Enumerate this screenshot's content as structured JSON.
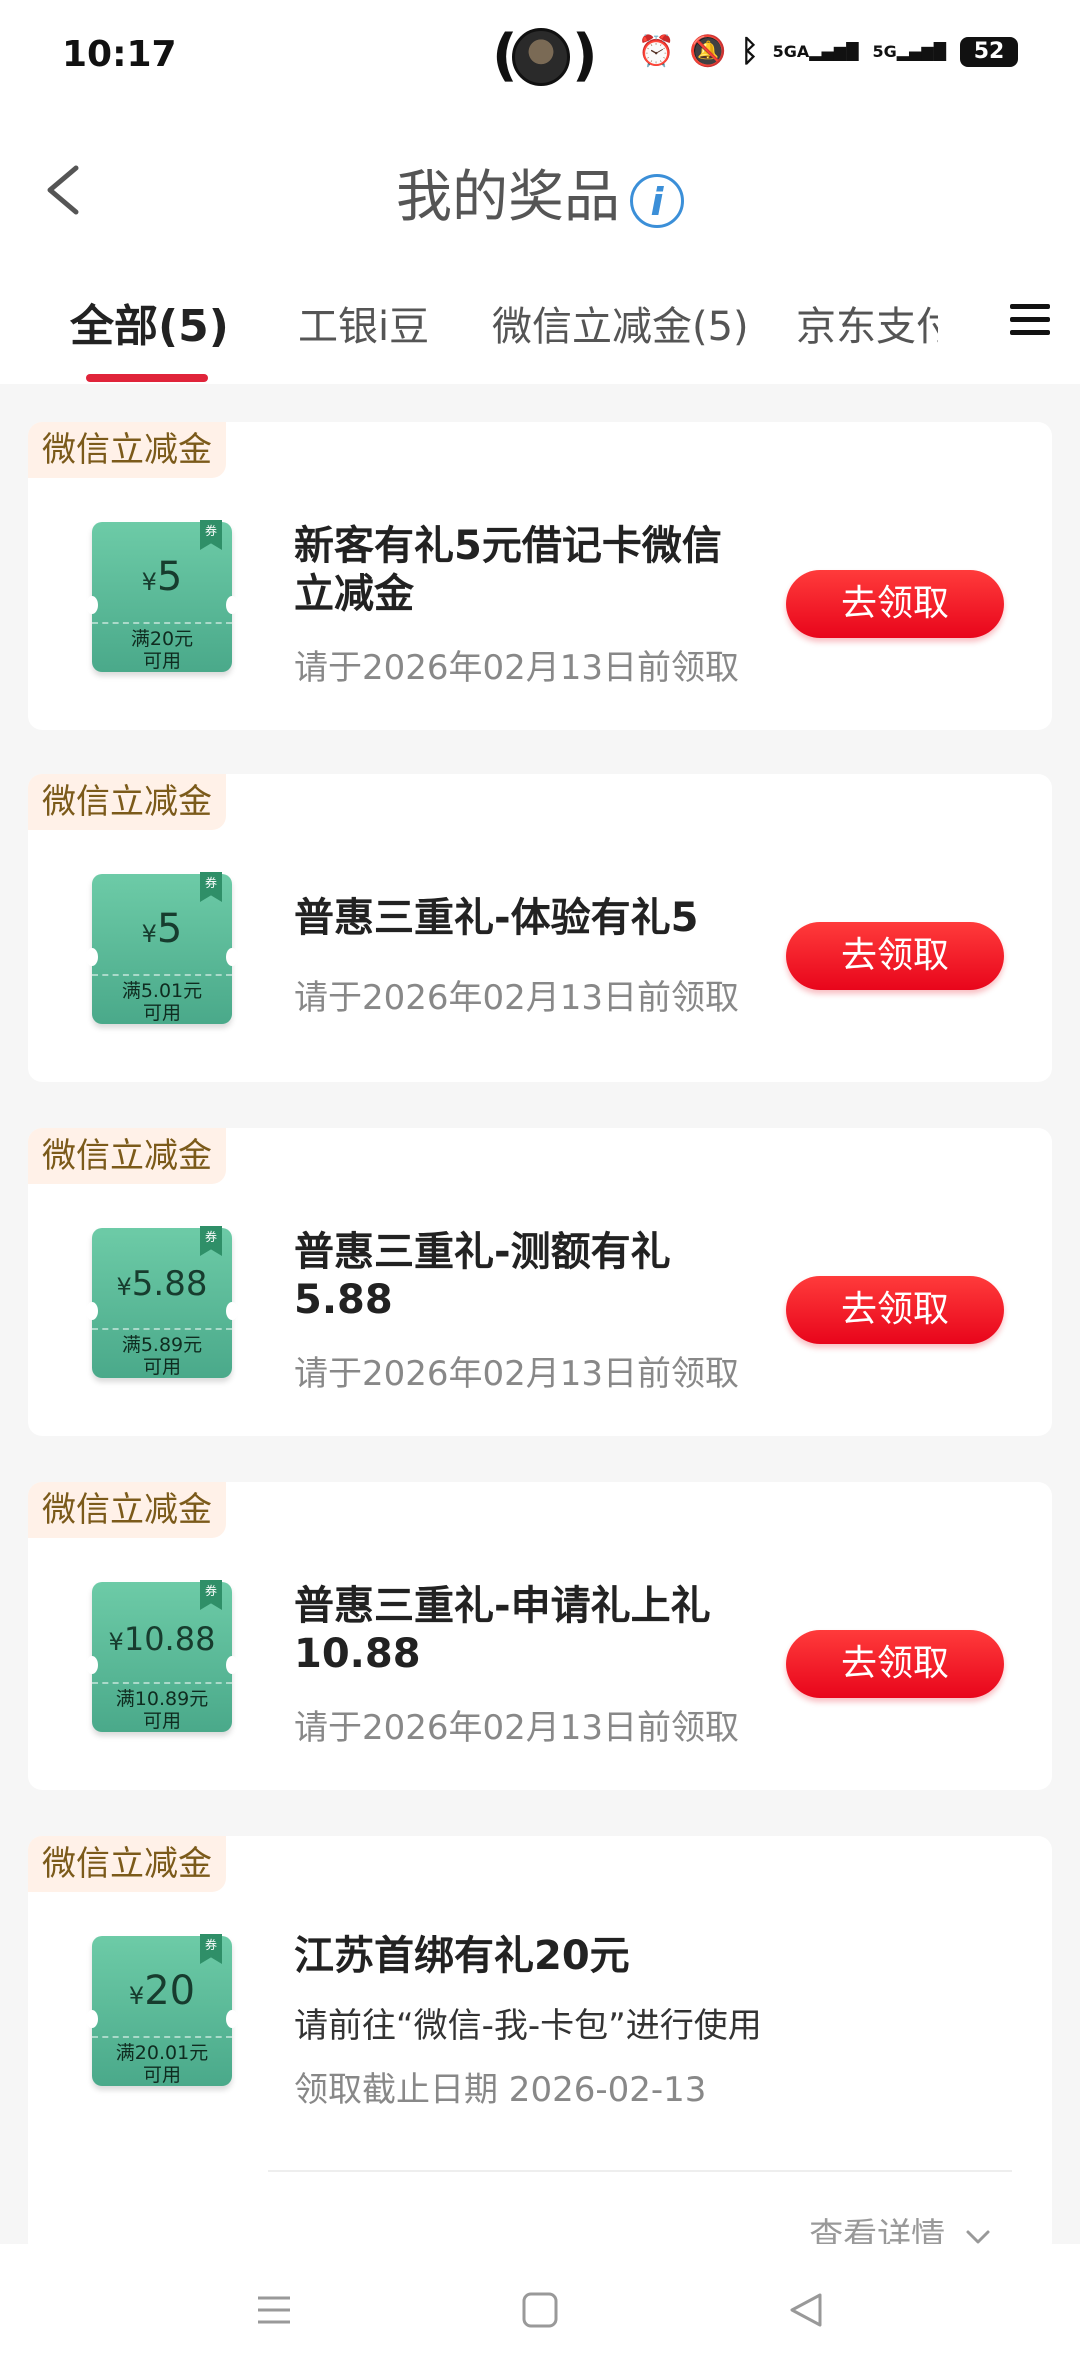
{
  "status_bar": {
    "time": "10:17",
    "battery": "52",
    "signal_labels": [
      "5GA",
      "5G"
    ]
  },
  "header": {
    "title": "我的奖品",
    "info_icon": "i"
  },
  "tabs": [
    {
      "label": "全部(5)",
      "active": true
    },
    {
      "label": "工银i豆",
      "active": false
    },
    {
      "label": "微信立减金(5)",
      "active": false
    },
    {
      "label": "京东支付",
      "active": false
    }
  ],
  "prizes": [
    {
      "tag": "微信立减金",
      "coupon_currency": "¥",
      "coupon_amount": "5",
      "coupon_condition": "满20元",
      "coupon_usable": "可用",
      "coupon_badge": "券",
      "name": "新客有礼5元借记卡微信立减金",
      "deadline": "请于2026年02月13日前领取",
      "action": "去领取"
    },
    {
      "tag": "微信立减金",
      "coupon_currency": "¥",
      "coupon_amount": "5",
      "coupon_condition": "满5.01元",
      "coupon_usable": "可用",
      "coupon_badge": "券",
      "name": "普惠三重礼-体验有礼5",
      "deadline": "请于2026年02月13日前领取",
      "action": "去领取"
    },
    {
      "tag": "微信立减金",
      "coupon_currency": "¥",
      "coupon_amount": "5.88",
      "coupon_condition": "满5.89元",
      "coupon_usable": "可用",
      "coupon_badge": "券",
      "name": "普惠三重礼-测额有礼5.88",
      "deadline": "请于2026年02月13日前领取",
      "action": "去领取"
    },
    {
      "tag": "微信立减金",
      "coupon_currency": "¥",
      "coupon_amount": "10.88",
      "coupon_condition": "满10.89元",
      "coupon_usable": "可用",
      "coupon_badge": "券",
      "name": "普惠三重礼-申请礼上礼10.88",
      "deadline": "请于2026年02月13日前领取",
      "action": "去领取"
    },
    {
      "tag": "微信立减金",
      "coupon_currency": "¥",
      "coupon_amount": "20",
      "coupon_condition": "满20.01元",
      "coupon_usable": "可用",
      "coupon_badge": "券",
      "name": "江苏首绑有礼20元",
      "usage_hint": "请前往“微信-我-卡包”进行使用",
      "deadline": "领取截止日期 2026-02-13",
      "details_link": "查看详情"
    }
  ]
}
